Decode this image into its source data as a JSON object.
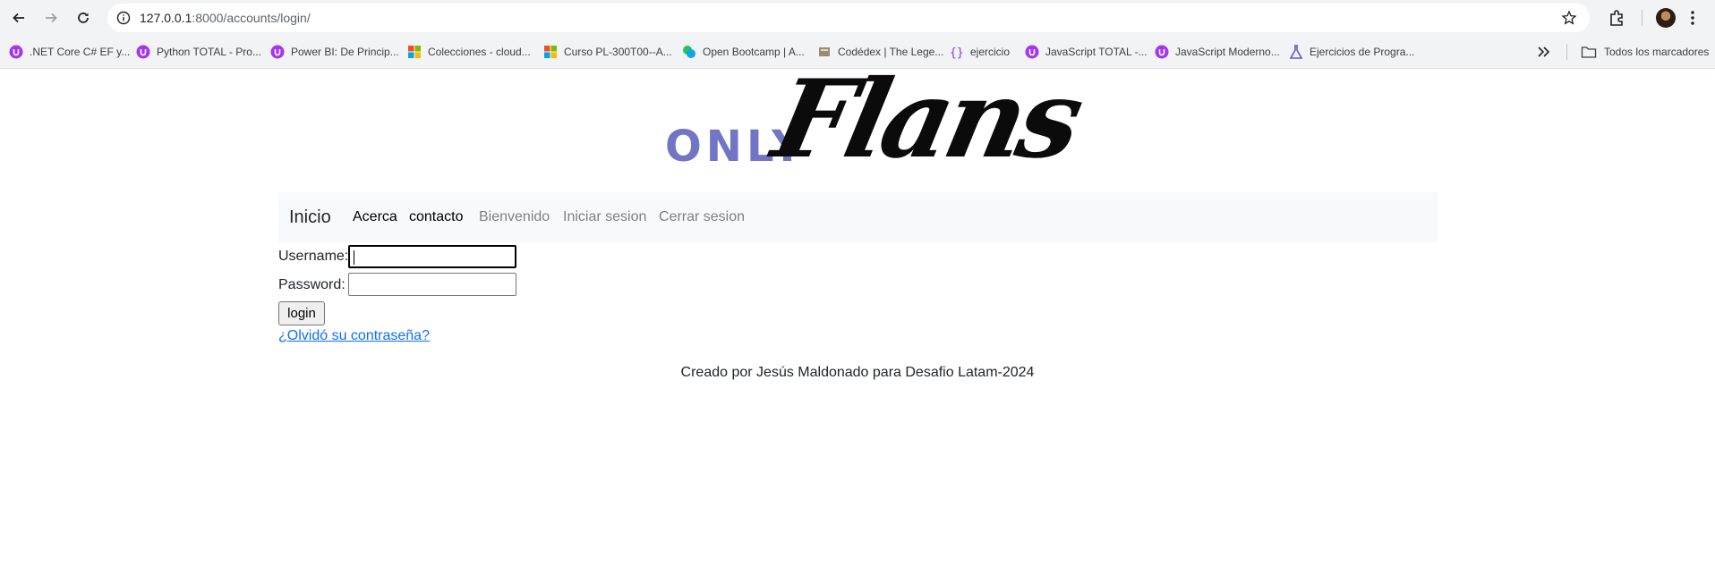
{
  "browser": {
    "url_host": "127.0.0.1",
    "url_path": ":8000/accounts/login/",
    "bookmarks": [
      {
        "label": ".NET Core C# EF y...",
        "icon": "udemy-icon",
        "color": "#a435f0"
      },
      {
        "label": "Python TOTAL - Pro...",
        "icon": "udemy-icon",
        "color": "#a435f0"
      },
      {
        "label": "Power BI: De Princip...",
        "icon": "udemy-icon",
        "color": "#a435f0"
      },
      {
        "label": "Colecciones - cloud...",
        "icon": "microsoft-icon",
        "color": "#f25022"
      },
      {
        "label": "Curso PL-300T00--A...",
        "icon": "microsoft-icon",
        "color": "#f25022"
      },
      {
        "label": "Open Bootcamp | A...",
        "icon": "openbootcamp-icon",
        "color": "#22c55e"
      },
      {
        "label": "Codédex | The Lege...",
        "icon": "codedex-icon",
        "color": "#9a8c74"
      },
      {
        "label": "ejercicio",
        "icon": "curly-braces-icon",
        "color": "#7c3aed"
      },
      {
        "label": "JavaScript TOTAL -...",
        "icon": "udemy-icon",
        "color": "#a435f0"
      },
      {
        "label": "JavaScript Moderno...",
        "icon": "udemy-icon",
        "color": "#a435f0"
      },
      {
        "label": "Ejercicios de Progra...",
        "icon": "flask-icon",
        "color": "#5b5fc7"
      }
    ],
    "all_bookmarks_label": "Todos los marcadores"
  },
  "logo": {
    "only": "ONLY",
    "fans": "Flans"
  },
  "navbar": {
    "brand": "Inicio",
    "links": [
      "Acerca",
      "contacto",
      "Bienvenido",
      "Iniciar sesion",
      "Cerrar sesion"
    ]
  },
  "form": {
    "username_label": "Username:",
    "username_value": "",
    "password_label": "Password:",
    "password_value": "",
    "submit_label": "login",
    "forgot_link": "¿Olvidó su contraseña?"
  },
  "footer": {
    "text": "Creado por Jesús Maldonado para Desafio Latam-2024"
  },
  "colors": {
    "logo_only": "#7076c4",
    "link": "#0d6efd",
    "navbar_bg": "#f8f9fa"
  }
}
